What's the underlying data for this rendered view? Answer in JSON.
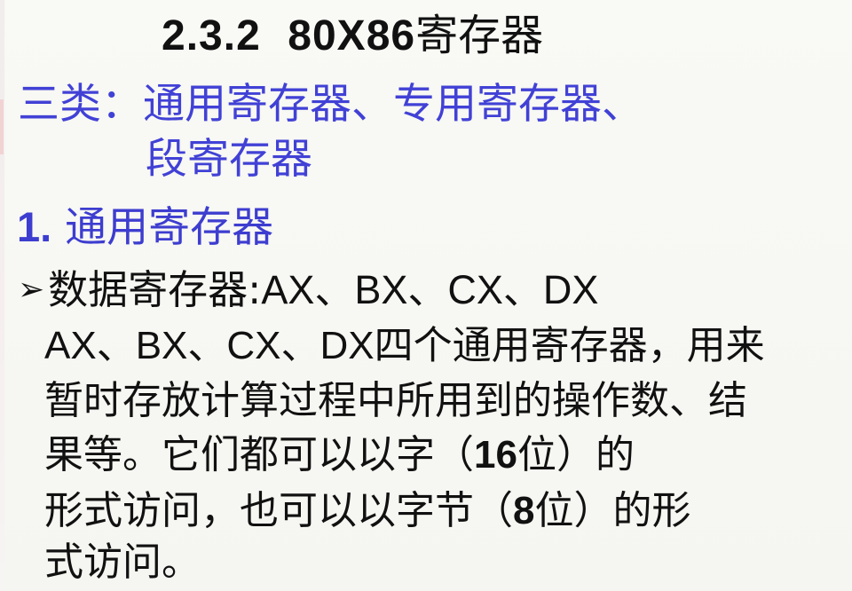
{
  "slide": {
    "title_num": "2.3.2",
    "title_model": "80X86",
    "title_text": "寄存器",
    "categories_line1": "三类：通用寄存器、专用寄存器、",
    "categories_line2": "段寄存器",
    "section_num": "1.",
    "section_title": "通用寄存器",
    "bullet_marker": "➢",
    "bullet_label": "数据寄存器:",
    "bullet_regs": "AX、BX、CX、DX",
    "para_line1_regs": "AX、BX、CX、DX",
    "para_line1_text": "四个通用寄存器，用来",
    "para_line2": "暂时存放计算过程中所用到的操作数、结",
    "para_line3_pre": "果等。它们都可以以字（",
    "para_line3_bits": "16",
    "para_line3_post": "位）的",
    "para_line4_pre": "形式访问，也可以以字节（",
    "para_line4_bits": "8",
    "para_line4_post": "位）的形",
    "para_line5": "式访问。"
  }
}
